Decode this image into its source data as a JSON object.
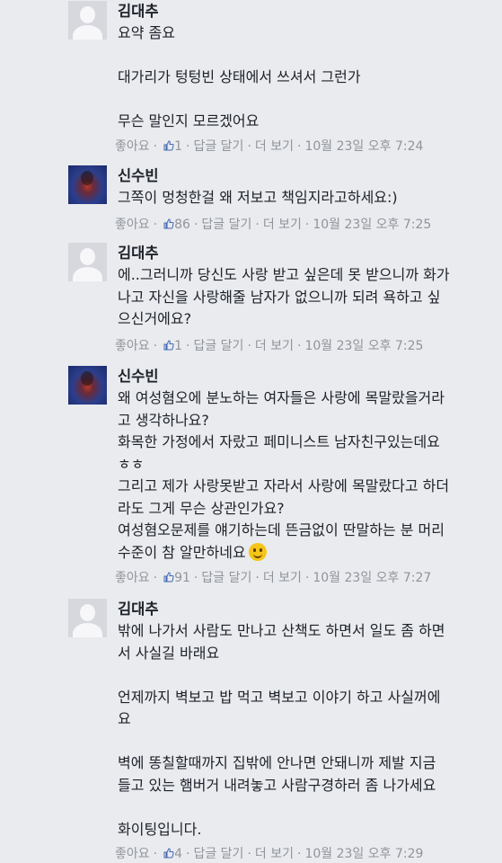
{
  "comments": [
    {
      "author": "김대추",
      "avatar": "default-avatar",
      "lines": [
        "요약 좀요",
        "",
        "대가리가 텅텅빈 상태에서 쓰셔서 그런가",
        "",
        "무슨 말인지 모르겠어요"
      ],
      "like_label": "좋아요",
      "like_count": "1",
      "reply_label": "답글 달기",
      "more_label": "더 보기",
      "timestamp": "10월 23일 오후 7:24"
    },
    {
      "author": "신수빈",
      "avatar": "photo-avatar",
      "lines": [
        "그쪽이 멍청한걸 왜 저보고 책임지라고하세요:)"
      ],
      "like_label": "좋아요",
      "like_count": "86",
      "reply_label": "답글 달기",
      "more_label": "더 보기",
      "timestamp": "10월 23일 오후 7:25"
    },
    {
      "author": "김대추",
      "avatar": "default-avatar",
      "lines": [
        "에..그러니까 당신도 사랑 받고 싶은데 못 받으니까 화가",
        "나고 자신을 사랑해줄 남자가 없으니까 되려 욕하고 싶",
        "으신거에요?"
      ],
      "like_label": "좋아요",
      "like_count": "1",
      "reply_label": "답글 달기",
      "more_label": "더 보기",
      "timestamp": "10월 23일 오후 7:25"
    },
    {
      "author": "신수빈",
      "avatar": "photo-avatar",
      "lines": [
        "왜 여성혐오에 분노하는 여자들은 사랑에 목말랐을거라",
        "고 생각하나요?",
        "화목한 가정에서 자랐고 페미니스트 남자친구있는데요",
        "ㅎㅎ",
        "그리고 제가 사랑못받고 자라서 사랑에 목말랐다고 하더",
        "라도 그게 무슨 상관인가요?",
        "여성혐오문제를 얘기하는데 뜬금없이 딴말하는 분 머리",
        "수준이 참 알만하네요"
      ],
      "emoji": "smile-emoji",
      "like_label": "좋아요",
      "like_count": "91",
      "reply_label": "답글 달기",
      "more_label": "더 보기",
      "timestamp": "10월 23일 오후 7:27"
    },
    {
      "author": "김대추",
      "avatar": "default-avatar",
      "lines": [
        "밖에 나가서 사람도 만나고 산책도 하면서 일도 좀 하면",
        "서 사실길 바래요",
        "",
        "언제까지 벽보고 밥 먹고 벽보고 이야기 하고 사실꺼에",
        "요",
        "",
        "벽에 똥칠할때까지 집밖에 안나면 안돼니까 제발 지금",
        "들고 있는 햄버거 내려놓고 사람구경하러 좀 나가세요",
        "",
        "화이팅입니다."
      ],
      "like_label": "좋아요",
      "like_count": "4",
      "reply_label": "답글 달기",
      "more_label": "더 보기",
      "timestamp": "10월 23일 오후 7:29"
    }
  ],
  "colors": {
    "meta": "#90949c",
    "text": "#1d2129",
    "background": "#e9ebee",
    "like_icon": "#4267b2"
  }
}
